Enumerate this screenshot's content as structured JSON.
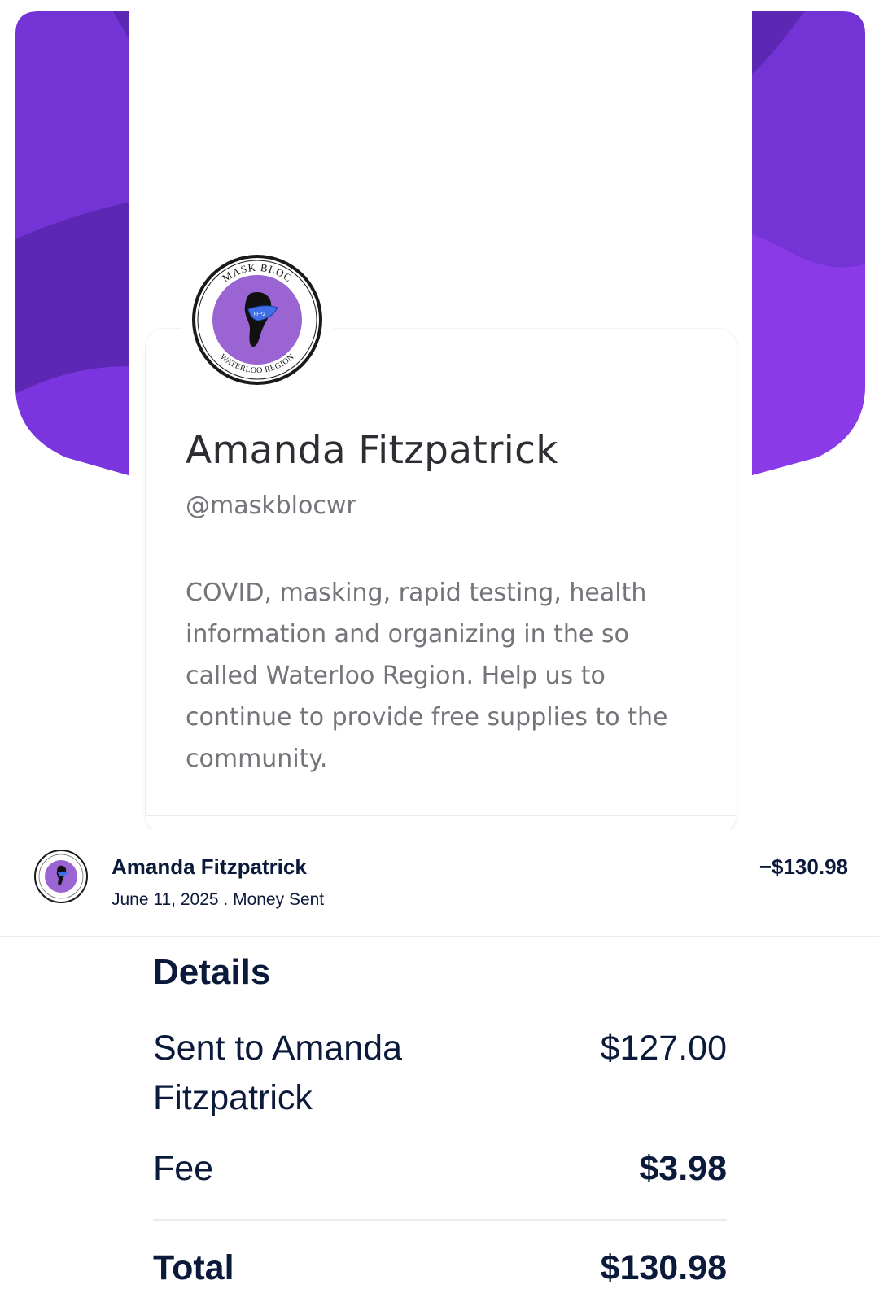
{
  "profile": {
    "name": "Amanda Fitzpatrick",
    "handle": "@maskblocwr",
    "bio": "COVID, masking, rapid testing, health information and organizing in the so called Waterloo Region. Help us to continue to provide free supplies to the community.",
    "logo_text": {
      "top": "MASK BLOC",
      "bottom": "WATERLOO REGION",
      "mask": "FFP2"
    }
  },
  "transaction": {
    "name": "Amanda Fitzpatrick",
    "date": "June 11, 2025",
    "separator": " . ",
    "type": "Money Sent",
    "amount": "−$130.98"
  },
  "details": {
    "title": "Details",
    "sent_label": "Sent to Amanda Fitzpatrick",
    "sent_value": "$127.00",
    "fee_label": "Fee",
    "fee_value": "$3.98",
    "total_label": "Total",
    "total_value": "$130.98"
  },
  "colors": {
    "banner_base": "#7433d5",
    "banner_dark": "#5c27b3",
    "banner_light": "#8a3ae6",
    "logo_purple": "#9a64d3",
    "text_navy": "#0b1a3b",
    "text_gray": "#74757a"
  },
  "icons": {
    "logo": "mask-bloc-logo-icon",
    "divider": "divider"
  }
}
